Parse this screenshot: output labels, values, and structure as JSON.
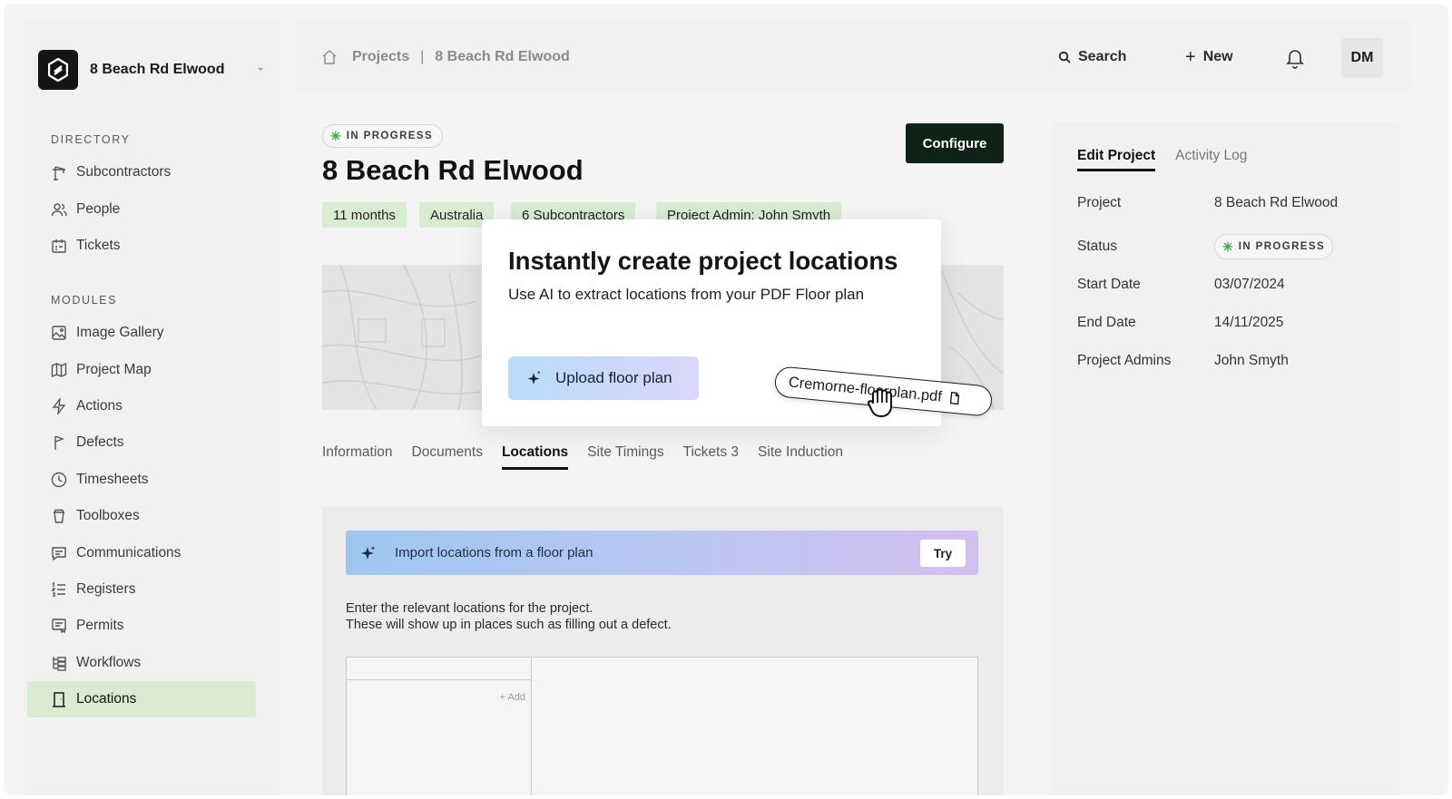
{
  "sidebar": {
    "project_name": "8 Beach Rd Elwood",
    "directory_label": "DIRECTORY",
    "directory_items": [
      {
        "label": "Subcontractors",
        "icon": "crane-icon"
      },
      {
        "label": "People",
        "icon": "people-icon"
      },
      {
        "label": "Tickets",
        "icon": "ticket-icon"
      }
    ],
    "modules_label": "MODULES",
    "module_items": [
      {
        "label": "Image Gallery",
        "icon": "image-icon"
      },
      {
        "label": "Project Map",
        "icon": "map-icon"
      },
      {
        "label": "Actions",
        "icon": "bolt-icon"
      },
      {
        "label": "Defects",
        "icon": "flag-icon"
      },
      {
        "label": "Timesheets",
        "icon": "clock-icon"
      },
      {
        "label": "Toolboxes",
        "icon": "cup-icon"
      },
      {
        "label": "Communications",
        "icon": "message-icon"
      },
      {
        "label": "Registers",
        "icon": "list-icon"
      },
      {
        "label": "Permits",
        "icon": "permit-icon"
      },
      {
        "label": "Workflows",
        "icon": "workflow-icon"
      },
      {
        "label": "Locations",
        "icon": "door-icon",
        "active": true
      }
    ]
  },
  "topbar": {
    "breadcrumb_root": "Projects",
    "breadcrumb_separator": "|",
    "breadcrumb_current": "8 Beach Rd Elwood",
    "search_label": "Search",
    "new_label": "New",
    "avatar_initials": "DM"
  },
  "main": {
    "status": "IN PROGRESS",
    "title": "8 Beach Rd Elwood",
    "configure_label": "Configure",
    "tags": [
      "11 months",
      "Australia",
      "6 Subcontractors",
      "Project Admin: John Smyth"
    ],
    "tabs": [
      {
        "label": "Information"
      },
      {
        "label": "Documents"
      },
      {
        "label": "Locations",
        "active": true
      },
      {
        "label": "Site Timings"
      },
      {
        "label": "Tickets 3"
      },
      {
        "label": "Site Induction"
      }
    ],
    "import_banner_text": "Import locations from a floor plan",
    "try_label": "Try",
    "help_line1": "Enter the relevant locations for the project.",
    "help_line2": "These will show up in places such as filling out a defect.",
    "add_label": "+ Add"
  },
  "modal": {
    "title": "Instantly create project locations",
    "subtitle": "Use AI to extract locations from your PDF Floor plan",
    "upload_label": "Upload floor plan",
    "file_name": "Cremorne-floorplan.pdf"
  },
  "right_panel": {
    "tabs": [
      {
        "label": "Edit Project",
        "active": true
      },
      {
        "label": "Activity Log"
      }
    ],
    "fields": {
      "project_label": "Project",
      "project_value": "8 Beach Rd Elwood",
      "status_label": "Status",
      "status_value": "IN PROGRESS",
      "start_label": "Start Date",
      "start_value": "03/07/2024",
      "end_label": "End Date",
      "end_value": "14/11/2025",
      "admins_label": "Project Admins",
      "admins_value": "John Smyth"
    }
  },
  "colors": {
    "active_nav": "#d9ecd2",
    "tag_bg": "#d8ecd1",
    "configure_bg": "#0f2218",
    "status_dot": "#3aa84c"
  }
}
